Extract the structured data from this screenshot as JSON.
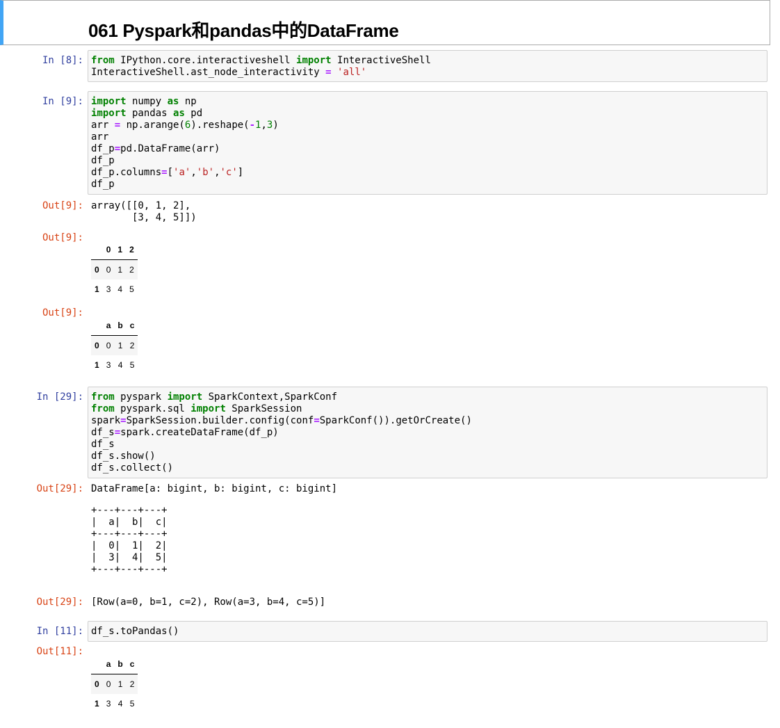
{
  "title": "061 Pyspark和pandas中的DataFrame",
  "cells": {
    "c8": {
      "prompt": "In [8]:"
    },
    "c9": {
      "prompt": "In [9]:",
      "out_prompt": "Out[9]:",
      "out1": "array([[0, 1, 2],\n       [3, 4, 5]])"
    },
    "c29": {
      "prompt": "In [29]:",
      "out_prompt": "Out[29]:",
      "out1": "DataFrame[a: bigint, b: bigint, c: bigint]",
      "out2": "+---+---+---+\n|  a|  b|  c|\n+---+---+---+\n|  0|  1|  2|\n|  3|  4|  5|\n+---+---+---+",
      "out3": "[Row(a=0, b=1, c=2), Row(a=3, b=4, c=5)]"
    },
    "c11": {
      "prompt": "In [11]:",
      "out_prompt": "Out[11]:"
    }
  },
  "tables": {
    "t1": {
      "columns": [
        "0",
        "1",
        "2"
      ],
      "index": [
        "0",
        "1"
      ],
      "rows": [
        [
          "0",
          "1",
          "2"
        ],
        [
          "3",
          "4",
          "5"
        ]
      ]
    },
    "t2": {
      "columns": [
        "a",
        "b",
        "c"
      ],
      "index": [
        "0",
        "1"
      ],
      "rows": [
        [
          "0",
          "1",
          "2"
        ],
        [
          "3",
          "4",
          "5"
        ]
      ]
    },
    "t3": {
      "columns": [
        "a",
        "b",
        "c"
      ],
      "index": [
        "0",
        "1"
      ],
      "rows": [
        [
          "0",
          "1",
          "2"
        ],
        [
          "3",
          "4",
          "5"
        ]
      ]
    }
  }
}
